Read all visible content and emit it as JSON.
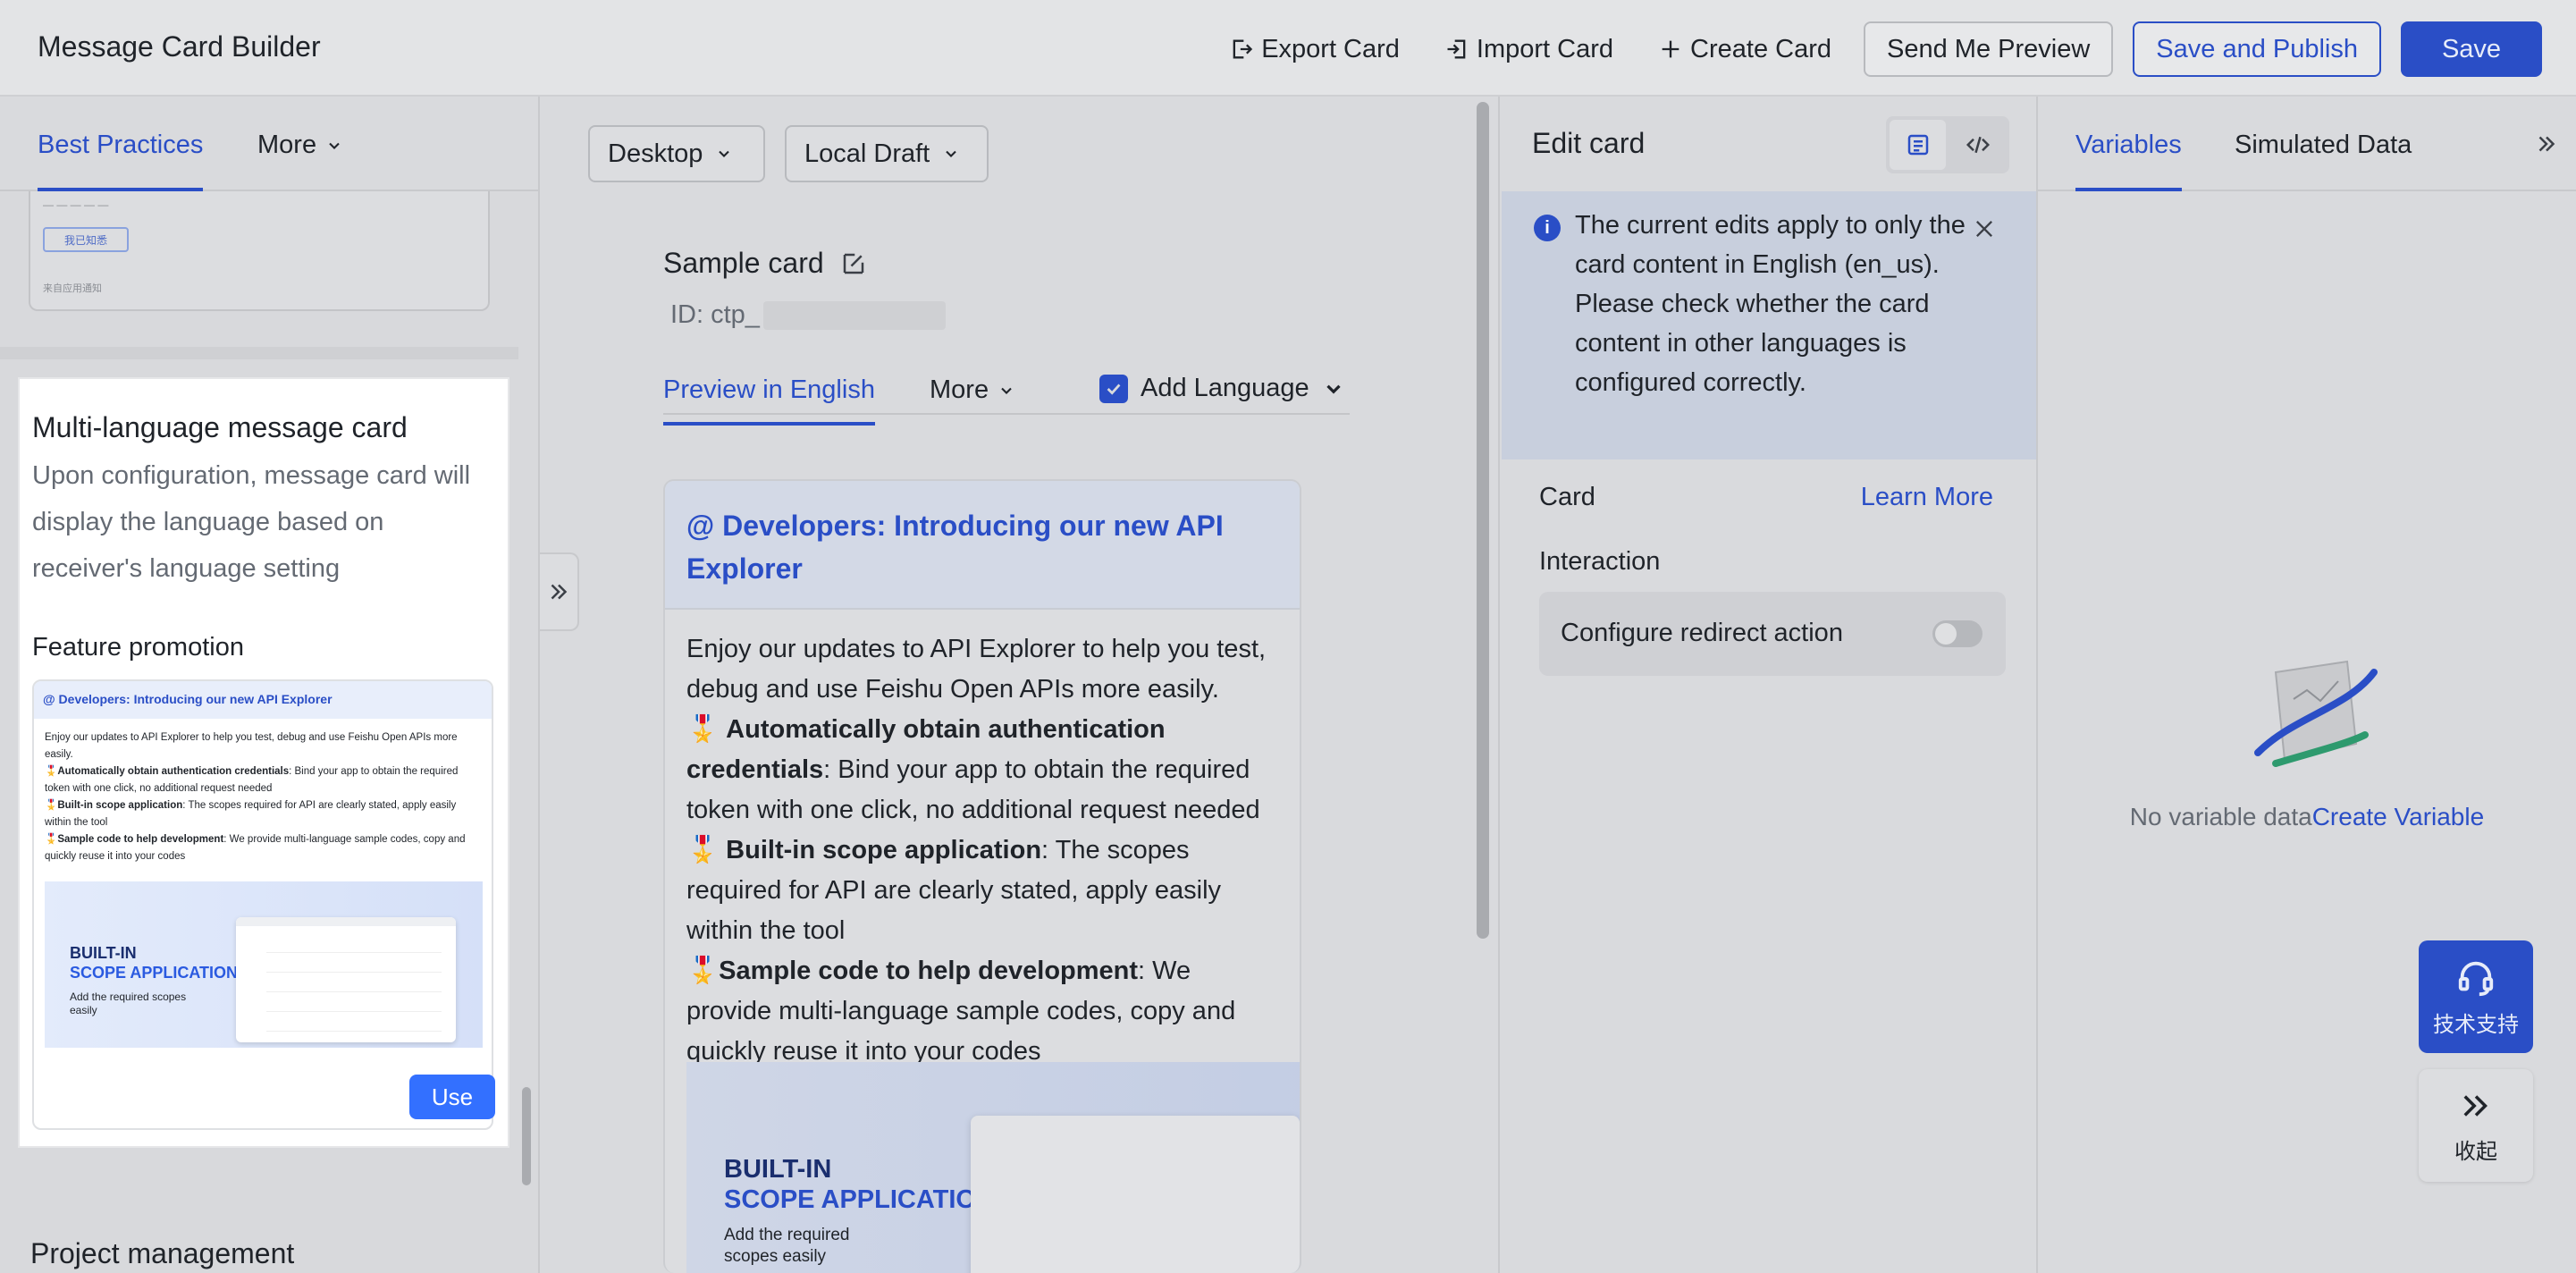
{
  "app": {
    "title": "Message Card Builder"
  },
  "toolbar": {
    "export_label": "Export Card",
    "import_label": "Import Card",
    "create_label": "Create Card",
    "send_preview_label": "Send Me Preview",
    "save_publish_label": "Save and Publish",
    "save_label": "Save"
  },
  "left": {
    "tabs": {
      "best_practices": "Best Practices",
      "more": "More"
    },
    "prev_card": {
      "button": "我已知悉",
      "note": "来自应用通知"
    },
    "template": {
      "title": "Multi-language message card",
      "description": "Upon configuration, message card will display the language based on receiver's language setting",
      "section": "Feature promotion",
      "preview_header": "@ Developers: Introducing our new API Explorer",
      "preview_intro": "Enjoy our updates to API Explorer to help you test, debug and use Feishu Open APIs more easily.",
      "preview_item1_bold": "Automatically obtain authentication credentials",
      "preview_item1_text": ": Bind your app to obtain the required token with one click, no additional request needed",
      "preview_item2_bold": "Built-in scope application",
      "preview_item2_text": ": The scopes required for API are clearly stated, apply easily within the tool",
      "preview_item3_bold": "Sample code to help development",
      "preview_item3_text": ": We provide multi-language sample codes, copy and quickly reuse it into your codes",
      "banner_line1": "BUILT-IN",
      "banner_line2": "SCOPE APPLICATION",
      "banner_line3": "Add the required scopes easily",
      "use_label": "Use"
    },
    "next_section_title": "Project management"
  },
  "center": {
    "device_label": "Desktop",
    "draft_label": "Local Draft",
    "card_title": "Sample card",
    "id_prefix": "ID: ctp_",
    "tabs": {
      "preview": "Preview in English",
      "more": "More",
      "add_language": "Add Language"
    },
    "card": {
      "header": "@ Developers: Introducing our new API Explorer",
      "intro": "Enjoy our updates to API Explorer to help you test, debug and use Feishu Open APIs more easily.",
      "item1_bold": "Automatically obtain authentication credentials",
      "item1_text": ": Bind your app to obtain the required token with one click, no additional request needed",
      "item2_bold": "Built-in scope application",
      "item2_text": ": The scopes required for API are clearly stated, apply easily within the tool",
      "item3_bold": "Sample code to help development",
      "item3_text": ": We provide multi-language sample codes, copy and quickly reuse it into your codes",
      "banner_line1": "BUILT-IN",
      "banner_line2": "SCOPE APPLICATION",
      "banner_line3": "Add the required scopes easily"
    }
  },
  "edit": {
    "title": "Edit card",
    "info": "The current edits apply to only the card content in English (en_us). Please check whether the card content in other languages is configured correctly.",
    "card_label": "Card",
    "learn_more": "Learn More",
    "interaction_label": "Interaction",
    "redirect_label": "Configure redirect action",
    "redirect_enabled": false
  },
  "variables": {
    "tab_variables": "Variables",
    "tab_simulated": "Simulated Data",
    "empty_text": "No variable data",
    "create_link": "Create Variable"
  },
  "float": {
    "support_label": "技术支持",
    "fold_label": "收起"
  },
  "colors": {
    "accent": "#2a4ec6",
    "use_button": "#3370ff"
  }
}
